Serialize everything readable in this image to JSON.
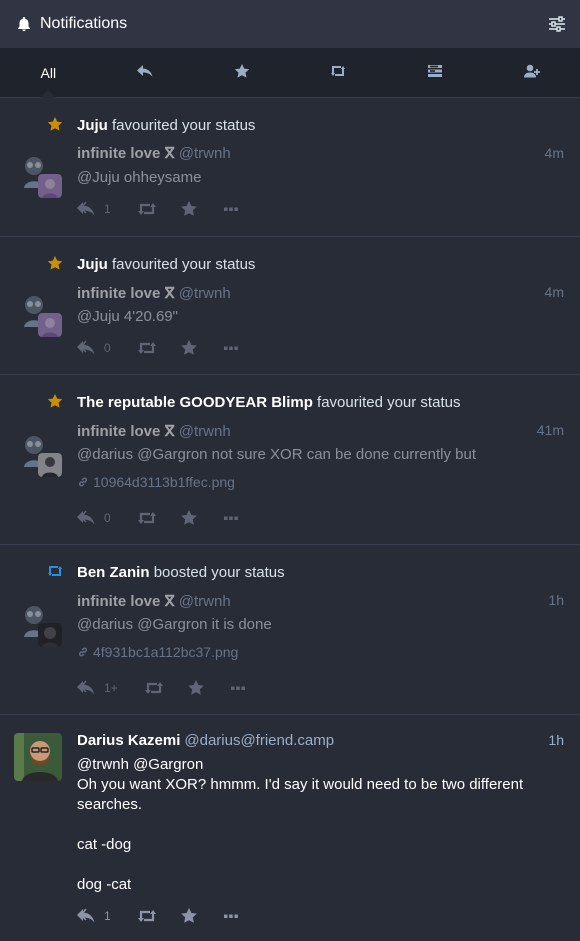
{
  "header": {
    "title": "Notifications",
    "icon": "bell-icon",
    "settings_icon": "sliders-icon"
  },
  "filters": [
    {
      "label": "All",
      "icon": null,
      "active": true
    },
    {
      "label": "",
      "icon": "reply-icon",
      "active": false
    },
    {
      "label": "",
      "icon": "star-icon",
      "active": false
    },
    {
      "label": "",
      "icon": "boost-icon",
      "active": false
    },
    {
      "label": "",
      "icon": "poll-icon",
      "active": false
    },
    {
      "label": "",
      "icon": "user-plus-icon",
      "active": false
    }
  ],
  "colors": {
    "star": "#ca8f04",
    "boost": "#2b90d9",
    "bg": "#282c37"
  },
  "notifications": [
    {
      "type": "favourite",
      "actor": "Juju",
      "action": "favourited your status",
      "status": {
        "display_name": "infinite love ⴳ",
        "handle": "@trwnh",
        "time": "4m",
        "content": "@Juju ohheysame",
        "replies": "1"
      }
    },
    {
      "type": "favourite",
      "actor": "Juju",
      "action": "favourited your status",
      "status": {
        "display_name": "infinite love ⴳ",
        "handle": "@trwnh",
        "time": "4m",
        "content": "@Juju 4'20.69\"",
        "replies": "0"
      }
    },
    {
      "type": "favourite",
      "actor": "The reputable GOODYEAR Blimp",
      "action": "favourited your status",
      "status": {
        "display_name": "infinite love ⴳ",
        "handle": "@trwnh",
        "time": "41m",
        "content": "@darius @Gargron not sure XOR can be done currently but",
        "attachment": "10964d3113b1ffec.png",
        "replies": "0"
      }
    },
    {
      "type": "reblog",
      "actor": "Ben Zanin",
      "action": "boosted your status",
      "status": {
        "display_name": "infinite love ⴳ",
        "handle": "@trwnh",
        "time": "1h",
        "content": "@darius @Gargron it is done",
        "attachment": "4f931bc1a112bc37.png",
        "replies": "1+"
      }
    },
    {
      "type": "mention",
      "status": {
        "display_name": "Darius Kazemi",
        "handle": "@darius@friend.camp",
        "time": "1h",
        "lines": [
          "@trwnh @Gargron",
          "Oh you want XOR? hmmm. I'd say it would need to be two different",
          "searches.",
          "",
          "cat -dog",
          "",
          "dog -cat"
        ],
        "replies": "1"
      }
    }
  ]
}
